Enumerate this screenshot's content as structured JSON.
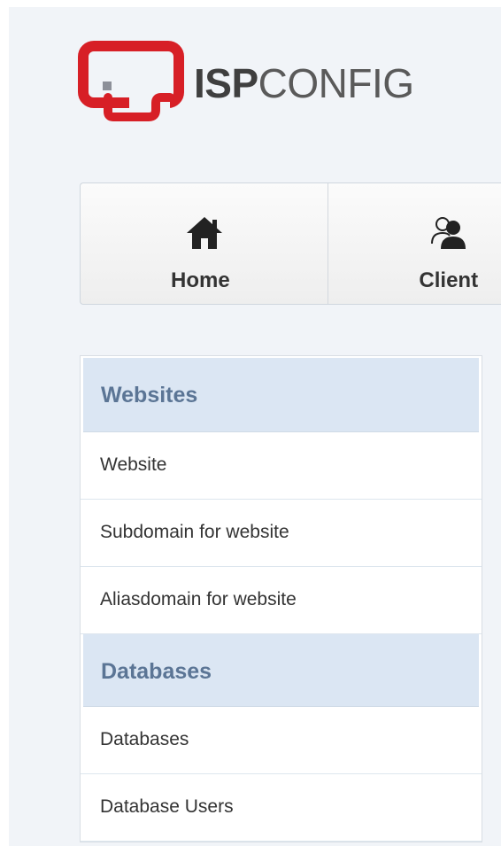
{
  "logo": {
    "text_bold": "ISP",
    "text_light": "CONFIG",
    "mark_color": "#d71f26"
  },
  "topnav": {
    "items": [
      {
        "label": "Home",
        "icon": "home-icon"
      },
      {
        "label": "Client",
        "icon": "client-icon"
      }
    ]
  },
  "sidemenu": {
    "sections": [
      {
        "header": "Websites",
        "items": [
          "Website",
          "Subdomain for website",
          "Aliasdomain for website"
        ]
      },
      {
        "header": "Databases",
        "items": [
          "Databases",
          "Database Users"
        ]
      }
    ]
  },
  "colors": {
    "background": "#f1f4f8",
    "section_header_bg": "#dbe6f3",
    "section_header_text": "#5b7595",
    "item_text": "#333333"
  }
}
